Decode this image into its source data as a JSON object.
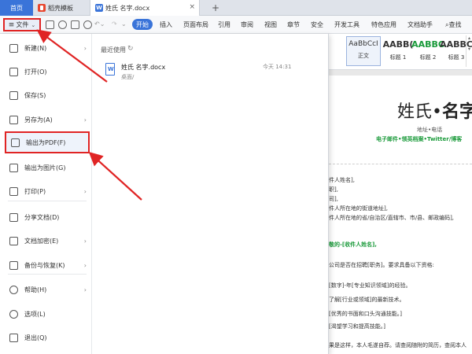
{
  "tabs": {
    "home": "首页",
    "template": "稻壳模板",
    "doc": "姓氏 名字.docx"
  },
  "menubar": {
    "file": "文件",
    "start": "开始",
    "items": [
      "插入",
      "页面布局",
      "引用",
      "审阅",
      "视图",
      "章节",
      "安全",
      "开发工具",
      "特色应用",
      "文档助手"
    ],
    "search": "查找"
  },
  "styles": [
    {
      "sample": "AaBbCcI",
      "name": "正文",
      "color": "#333333"
    },
    {
      "sample": "AABB(",
      "name": "标题 1",
      "color": "#222222"
    },
    {
      "sample": "AABBC",
      "name": "标题 2",
      "color": "#1a9a3a"
    },
    {
      "sample": "AABBC",
      "name": "标题 3",
      "color": "#222222"
    }
  ],
  "file_menu": {
    "items": [
      {
        "label": "新建(N)",
        "icon": "new-icon",
        "arrow": true
      },
      {
        "label": "打开(O)",
        "icon": "open-folder-icon",
        "arrow": false
      },
      {
        "label": "保存(S)",
        "icon": "save-icon",
        "arrow": false
      },
      {
        "label": "另存为(A)",
        "icon": "save-as-icon",
        "arrow": true
      },
      {
        "label": "输出为PDF(F)",
        "icon": "export-pdf-icon",
        "arrow": false
      },
      {
        "label": "输出为图片(G)",
        "icon": "export-image-icon",
        "arrow": false
      },
      {
        "label": "打印(P)",
        "icon": "print-icon",
        "arrow": true
      },
      {
        "label": "分享文档(D)",
        "icon": "share-icon",
        "arrow": false
      },
      {
        "label": "文档加密(E)",
        "icon": "lock-icon",
        "arrow": true
      },
      {
        "label": "备份与恢复(K)",
        "icon": "backup-icon",
        "arrow": true
      },
      {
        "label": "帮助(H)",
        "icon": "help-icon",
        "arrow": true
      },
      {
        "label": "选项(L)",
        "icon": "gear-icon",
        "arrow": false
      },
      {
        "label": "退出(Q)",
        "icon": "exit-icon",
        "arrow": false
      }
    ],
    "recent_title": "最近使用",
    "recent": [
      {
        "name": "姓氏 名字.docx",
        "path": "桌面/",
        "time": "今天 14:31"
      }
    ]
  },
  "document": {
    "name_plain": "姓氏•",
    "name_bold": "名字",
    "contact": "地址•电话",
    "links": "电子邮件•领英档案•Twitter/博客",
    "lines": [
      "件人姓名],",
      "职],",
      "司],",
      "件人所在地的街道地址],",
      "件人所在地的省/自治区/直辖市、市/县、邮政编码],"
    ],
    "greeting": "敬的-[收件人姓名],",
    "body1": "公司是否在招聘[职务]。要求具备以下资格:",
    "bullets": [
      "[数字]-年[专业知识领域]的经验。",
      "了解[行业或领域]的最新技术。",
      "[优秀的书面和口头沟通技能。]",
      "[渴望学习和提高技能。]"
    ],
    "body2": "果是这样，本人毛遂自荐。请查阅随附的简历，查阅本人"
  },
  "colors": {
    "accent": "#3a74d9",
    "highlight_border": "#e02424",
    "doc_green": "#1a9a3a"
  }
}
